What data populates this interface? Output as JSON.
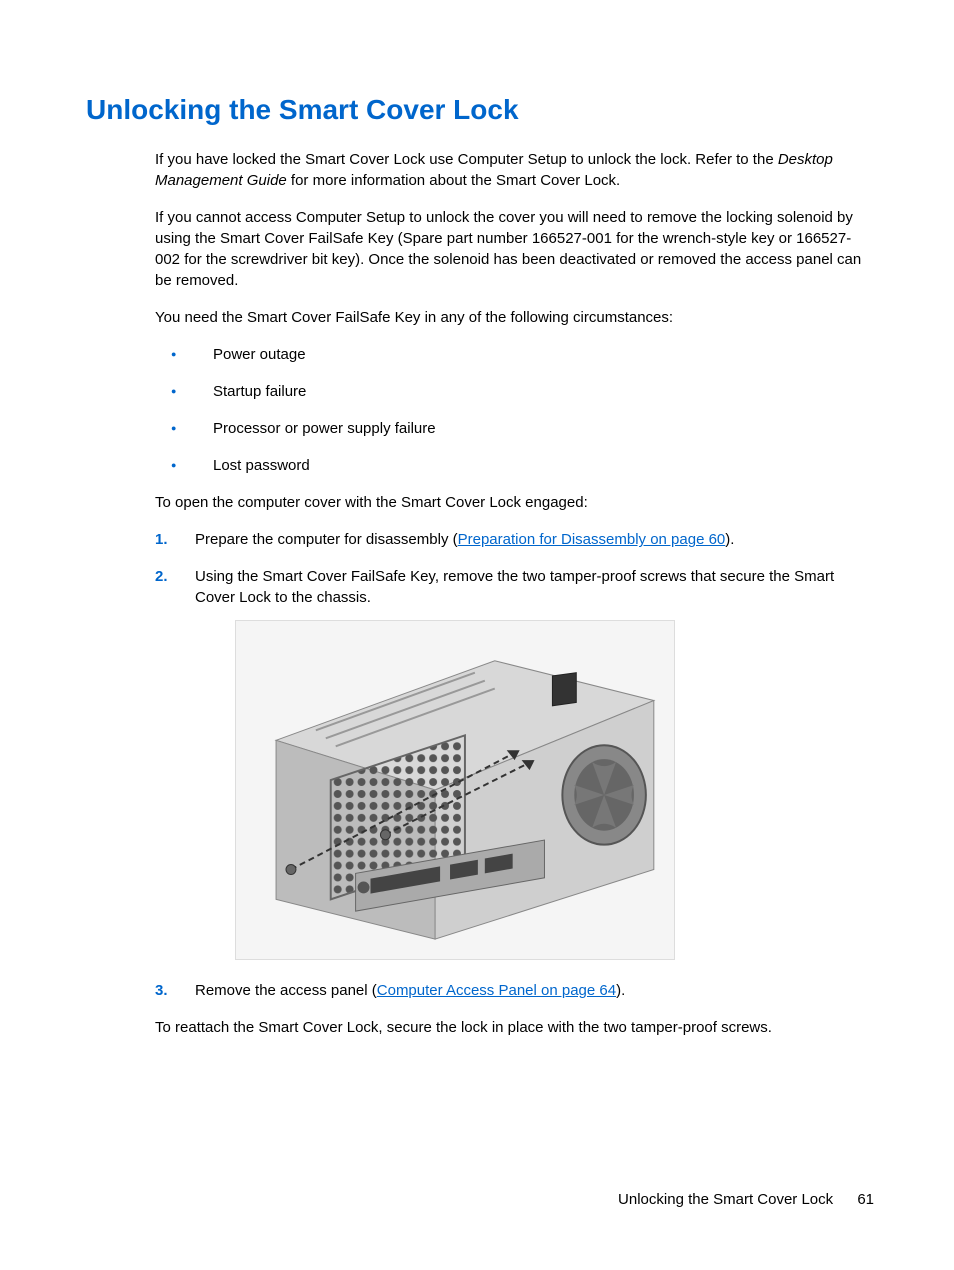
{
  "heading": "Unlocking the Smart Cover Lock",
  "para1a": "If you have locked the Smart Cover Lock use Computer Setup to unlock the lock. Refer to the ",
  "para1b": "Desktop Management Guide",
  "para1c": " for more information about the Smart Cover Lock.",
  "para2": "If you cannot access Computer Setup to unlock the cover you will need to remove the locking solenoid by using the Smart Cover FailSafe Key (Spare part number 166527-001 for the wrench-style key or 166527-002 for the screwdriver bit key). Once the solenoid has been deactivated or removed the access panel can be removed.",
  "para3": "You need the Smart Cover FailSafe Key in any of the following circumstances:",
  "bullets": [
    "Power outage",
    "Startup failure",
    "Processor or power supply failure",
    "Lost password"
  ],
  "para4": "To open the computer cover with the Smart Cover Lock engaged:",
  "step1": {
    "num": "1.",
    "text_before": "Prepare the computer for disassembly (",
    "link": "Preparation for Disassembly on page 60",
    "text_after": ")."
  },
  "step2": {
    "num": "2.",
    "text": "Using the Smart Cover FailSafe Key, remove the two tamper-proof screws that secure the Smart Cover Lock to the chassis."
  },
  "step3": {
    "num": "3.",
    "text_before": "Remove the access panel (",
    "link": "Computer Access Panel on page 64",
    "text_after": ")."
  },
  "para5": "To reattach the Smart Cover Lock, secure the lock in place with the two tamper-proof screws.",
  "footer_text": "Unlocking the Smart Cover Lock",
  "page_number": "61"
}
